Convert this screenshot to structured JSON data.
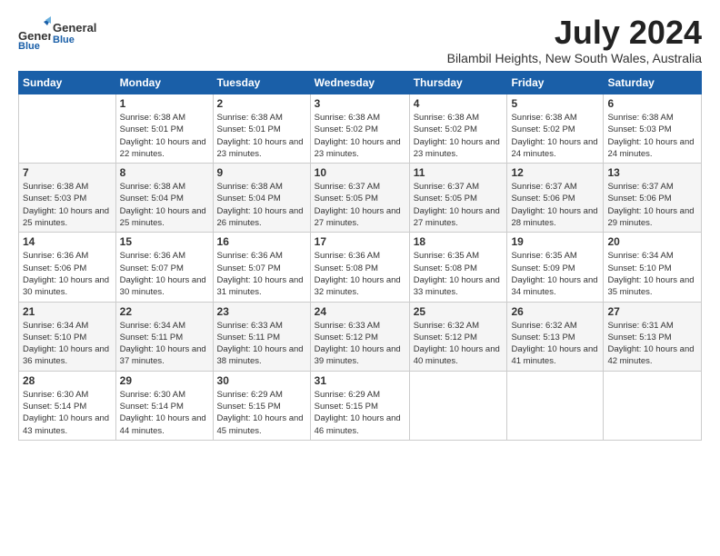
{
  "logo": {
    "line1": "General",
    "line2": "Blue"
  },
  "title": "July 2024",
  "location": "Bilambil Heights, New South Wales, Australia",
  "days_of_week": [
    "Sunday",
    "Monday",
    "Tuesday",
    "Wednesday",
    "Thursday",
    "Friday",
    "Saturday"
  ],
  "weeks": [
    [
      {
        "day": "",
        "sunrise": "",
        "sunset": "",
        "daylight": ""
      },
      {
        "day": "1",
        "sunrise": "Sunrise: 6:38 AM",
        "sunset": "Sunset: 5:01 PM",
        "daylight": "Daylight: 10 hours and 22 minutes."
      },
      {
        "day": "2",
        "sunrise": "Sunrise: 6:38 AM",
        "sunset": "Sunset: 5:01 PM",
        "daylight": "Daylight: 10 hours and 23 minutes."
      },
      {
        "day": "3",
        "sunrise": "Sunrise: 6:38 AM",
        "sunset": "Sunset: 5:02 PM",
        "daylight": "Daylight: 10 hours and 23 minutes."
      },
      {
        "day": "4",
        "sunrise": "Sunrise: 6:38 AM",
        "sunset": "Sunset: 5:02 PM",
        "daylight": "Daylight: 10 hours and 23 minutes."
      },
      {
        "day": "5",
        "sunrise": "Sunrise: 6:38 AM",
        "sunset": "Sunset: 5:02 PM",
        "daylight": "Daylight: 10 hours and 24 minutes."
      },
      {
        "day": "6",
        "sunrise": "Sunrise: 6:38 AM",
        "sunset": "Sunset: 5:03 PM",
        "daylight": "Daylight: 10 hours and 24 minutes."
      }
    ],
    [
      {
        "day": "7",
        "sunrise": "Sunrise: 6:38 AM",
        "sunset": "Sunset: 5:03 PM",
        "daylight": "Daylight: 10 hours and 25 minutes."
      },
      {
        "day": "8",
        "sunrise": "Sunrise: 6:38 AM",
        "sunset": "Sunset: 5:04 PM",
        "daylight": "Daylight: 10 hours and 25 minutes."
      },
      {
        "day": "9",
        "sunrise": "Sunrise: 6:38 AM",
        "sunset": "Sunset: 5:04 PM",
        "daylight": "Daylight: 10 hours and 26 minutes."
      },
      {
        "day": "10",
        "sunrise": "Sunrise: 6:37 AM",
        "sunset": "Sunset: 5:05 PM",
        "daylight": "Daylight: 10 hours and 27 minutes."
      },
      {
        "day": "11",
        "sunrise": "Sunrise: 6:37 AM",
        "sunset": "Sunset: 5:05 PM",
        "daylight": "Daylight: 10 hours and 27 minutes."
      },
      {
        "day": "12",
        "sunrise": "Sunrise: 6:37 AM",
        "sunset": "Sunset: 5:06 PM",
        "daylight": "Daylight: 10 hours and 28 minutes."
      },
      {
        "day": "13",
        "sunrise": "Sunrise: 6:37 AM",
        "sunset": "Sunset: 5:06 PM",
        "daylight": "Daylight: 10 hours and 29 minutes."
      }
    ],
    [
      {
        "day": "14",
        "sunrise": "Sunrise: 6:36 AM",
        "sunset": "Sunset: 5:06 PM",
        "daylight": "Daylight: 10 hours and 30 minutes."
      },
      {
        "day": "15",
        "sunrise": "Sunrise: 6:36 AM",
        "sunset": "Sunset: 5:07 PM",
        "daylight": "Daylight: 10 hours and 30 minutes."
      },
      {
        "day": "16",
        "sunrise": "Sunrise: 6:36 AM",
        "sunset": "Sunset: 5:07 PM",
        "daylight": "Daylight: 10 hours and 31 minutes."
      },
      {
        "day": "17",
        "sunrise": "Sunrise: 6:36 AM",
        "sunset": "Sunset: 5:08 PM",
        "daylight": "Daylight: 10 hours and 32 minutes."
      },
      {
        "day": "18",
        "sunrise": "Sunrise: 6:35 AM",
        "sunset": "Sunset: 5:08 PM",
        "daylight": "Daylight: 10 hours and 33 minutes."
      },
      {
        "day": "19",
        "sunrise": "Sunrise: 6:35 AM",
        "sunset": "Sunset: 5:09 PM",
        "daylight": "Daylight: 10 hours and 34 minutes."
      },
      {
        "day": "20",
        "sunrise": "Sunrise: 6:34 AM",
        "sunset": "Sunset: 5:10 PM",
        "daylight": "Daylight: 10 hours and 35 minutes."
      }
    ],
    [
      {
        "day": "21",
        "sunrise": "Sunrise: 6:34 AM",
        "sunset": "Sunset: 5:10 PM",
        "daylight": "Daylight: 10 hours and 36 minutes."
      },
      {
        "day": "22",
        "sunrise": "Sunrise: 6:34 AM",
        "sunset": "Sunset: 5:11 PM",
        "daylight": "Daylight: 10 hours and 37 minutes."
      },
      {
        "day": "23",
        "sunrise": "Sunrise: 6:33 AM",
        "sunset": "Sunset: 5:11 PM",
        "daylight": "Daylight: 10 hours and 38 minutes."
      },
      {
        "day": "24",
        "sunrise": "Sunrise: 6:33 AM",
        "sunset": "Sunset: 5:12 PM",
        "daylight": "Daylight: 10 hours and 39 minutes."
      },
      {
        "day": "25",
        "sunrise": "Sunrise: 6:32 AM",
        "sunset": "Sunset: 5:12 PM",
        "daylight": "Daylight: 10 hours and 40 minutes."
      },
      {
        "day": "26",
        "sunrise": "Sunrise: 6:32 AM",
        "sunset": "Sunset: 5:13 PM",
        "daylight": "Daylight: 10 hours and 41 minutes."
      },
      {
        "day": "27",
        "sunrise": "Sunrise: 6:31 AM",
        "sunset": "Sunset: 5:13 PM",
        "daylight": "Daylight: 10 hours and 42 minutes."
      }
    ],
    [
      {
        "day": "28",
        "sunrise": "Sunrise: 6:30 AM",
        "sunset": "Sunset: 5:14 PM",
        "daylight": "Daylight: 10 hours and 43 minutes."
      },
      {
        "day": "29",
        "sunrise": "Sunrise: 6:30 AM",
        "sunset": "Sunset: 5:14 PM",
        "daylight": "Daylight: 10 hours and 44 minutes."
      },
      {
        "day": "30",
        "sunrise": "Sunrise: 6:29 AM",
        "sunset": "Sunset: 5:15 PM",
        "daylight": "Daylight: 10 hours and 45 minutes."
      },
      {
        "day": "31",
        "sunrise": "Sunrise: 6:29 AM",
        "sunset": "Sunset: 5:15 PM",
        "daylight": "Daylight: 10 hours and 46 minutes."
      },
      {
        "day": "",
        "sunrise": "",
        "sunset": "",
        "daylight": ""
      },
      {
        "day": "",
        "sunrise": "",
        "sunset": "",
        "daylight": ""
      },
      {
        "day": "",
        "sunrise": "",
        "sunset": "",
        "daylight": ""
      }
    ]
  ]
}
